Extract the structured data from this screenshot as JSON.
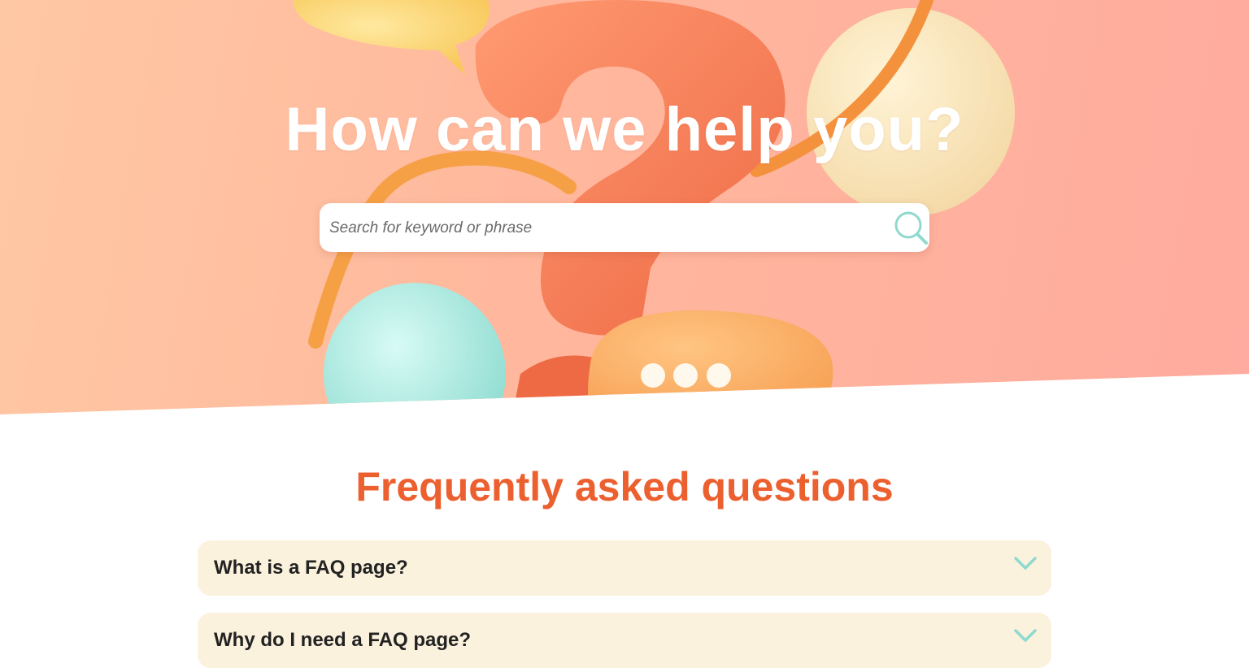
{
  "hero": {
    "title": "How can we help you?",
    "search": {
      "placeholder": "Search for keyword or phrase",
      "value": "",
      "icon": "search-icon"
    },
    "colors": {
      "gradient_start": "#ffc8a4",
      "gradient_end": "#ffab9f",
      "question_mark": "#f47a55",
      "accent_teal": "#8fd9cf"
    }
  },
  "faq": {
    "heading": "Frequently asked questions",
    "heading_color": "#ec5f2e",
    "item_background": "#fbf2dd",
    "items": [
      {
        "question": "What is a FAQ page?",
        "icon": "chevron-down-icon"
      },
      {
        "question": "Why do I need a FAQ page?",
        "icon": "chevron-down-icon"
      }
    ]
  }
}
